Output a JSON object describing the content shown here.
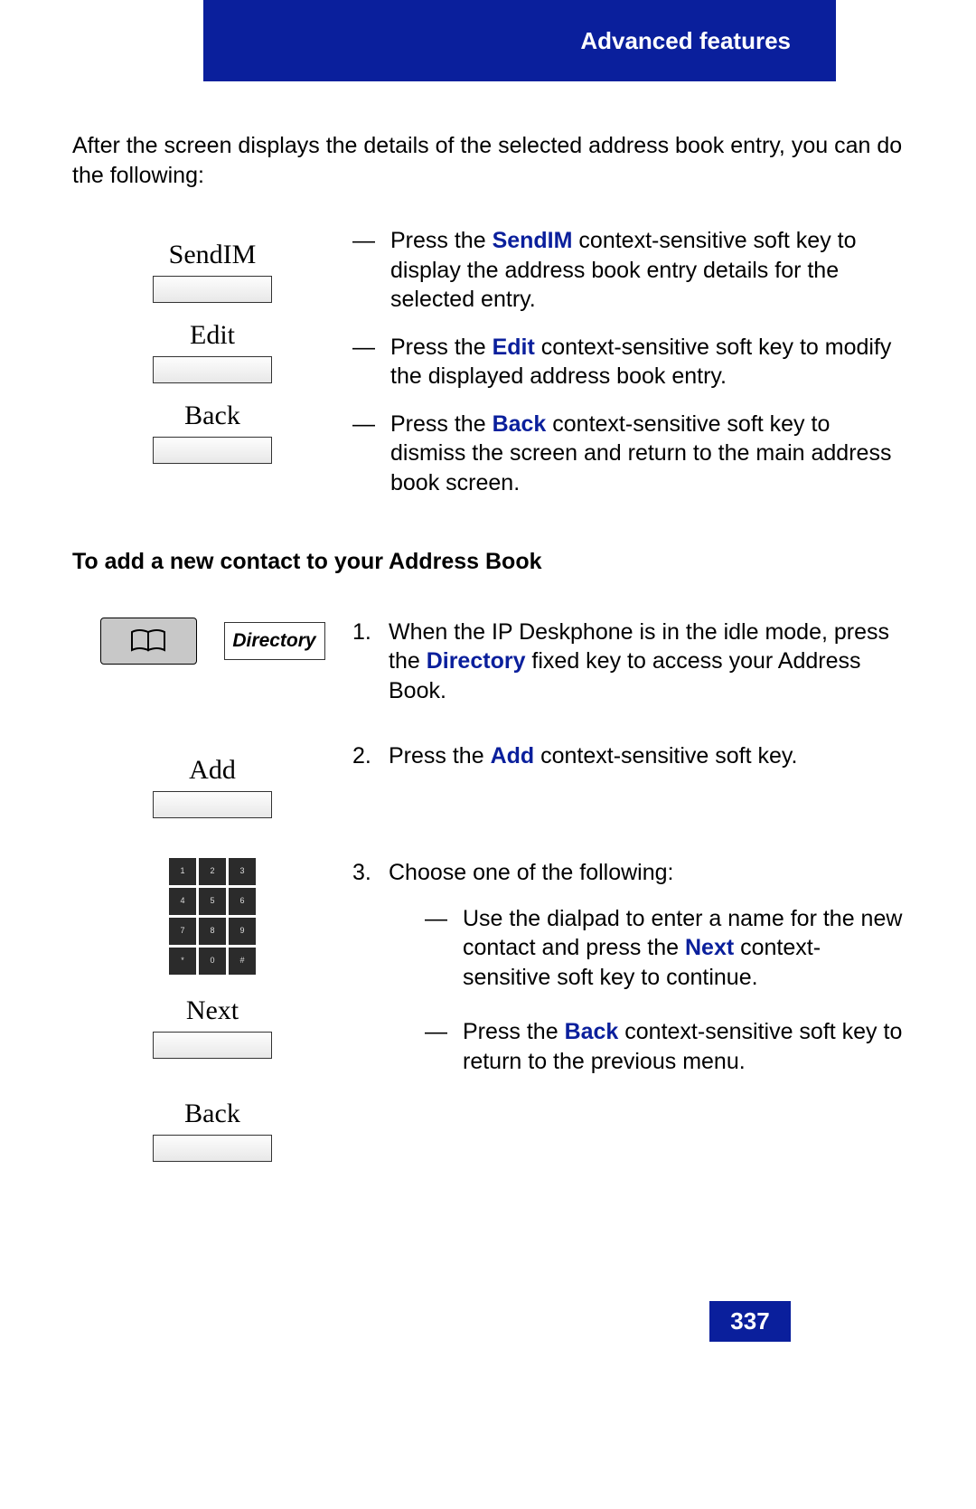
{
  "header": {
    "title": "Advanced features"
  },
  "intro": "After the screen displays the details of the selected address book entry, you can do the following:",
  "softkeys1": {
    "sendim": "SendIM",
    "edit": "Edit",
    "back": "Back"
  },
  "list1": {
    "i1_a": "Press the ",
    "i1_b": "SendIM",
    "i1_c": " context-sensitive soft key to display the address book entry details for the selected entry.",
    "i2_a": "Press the ",
    "i2_b": "Edit",
    "i2_c": " context-sensitive soft key to modify the displayed address book entry.",
    "i3_a": "Press the ",
    "i3_b": "Back",
    "i3_c": " context-sensitive soft key to dismiss the screen and return to the main address book screen."
  },
  "heading2": "To add a new contact to your Address Book",
  "directory_label": "Directory",
  "step1": {
    "num": "1.",
    "a": "When the IP Deskphone is in the idle mode, press the ",
    "b": "Directory",
    "c": " fixed key to access your Address Book."
  },
  "softkeys2": {
    "add": "Add"
  },
  "step2": {
    "num": "2.",
    "a": "Press the ",
    "b": "Add",
    "c": " context-sensitive soft key."
  },
  "keypad": [
    "1",
    "2",
    "3",
    "4",
    "5",
    "6",
    "7",
    "8",
    "9",
    "*",
    "0",
    "#"
  ],
  "softkeys3": {
    "next": "Next",
    "back": "Back"
  },
  "step3": {
    "num": "3.",
    "intro": "Choose one of the following:",
    "s1_a": "Use the dialpad to enter a name for the new contact and press the ",
    "s1_b": "Next",
    "s1_c": " context-sensitive soft key to continue.",
    "s2_a": "Press the ",
    "s2_b": "Back",
    "s2_c": " context-sensitive soft key to return to the previous menu."
  },
  "page_number": "337"
}
